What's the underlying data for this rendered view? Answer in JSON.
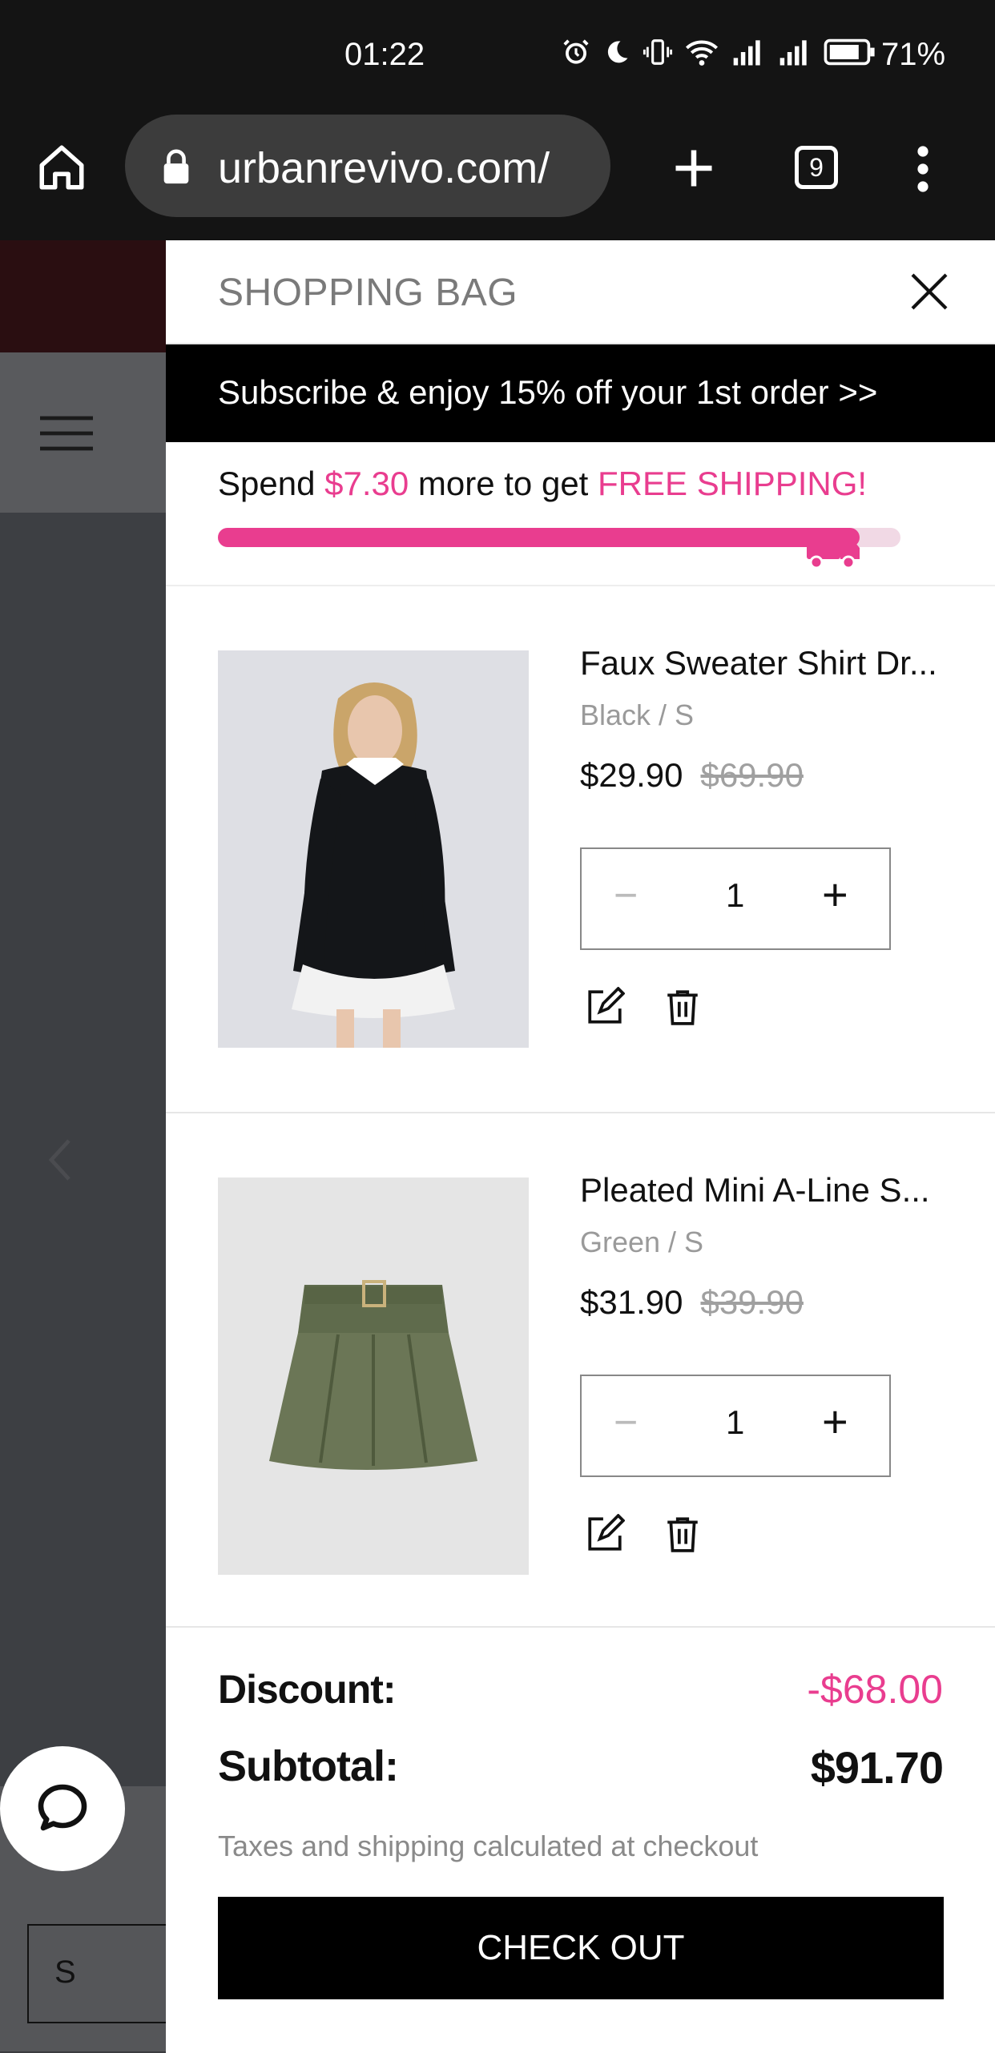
{
  "status_bar": {
    "time": "01:22",
    "battery": "71%"
  },
  "browser": {
    "url": "urbanrevivo.com/",
    "tab_count": "9"
  },
  "background_page": {
    "size_box": "S"
  },
  "drawer": {
    "title": "SHOPPING BAG",
    "promo": "Subscribe & enjoy 15% off your 1st order >>",
    "shipping": {
      "prefix": "Spend ",
      "amount": "$7.30",
      "middle": " more to get ",
      "free": "FREE SHIPPING!",
      "progress": 0.94
    },
    "items": [
      {
        "name": "Faux Sweater Shirt Dr...",
        "variant": "Black / S",
        "price": "$29.90",
        "old_price": "$69.90",
        "qty": "1",
        "minus": "−",
        "plus": "+"
      },
      {
        "name": "Pleated Mini A-Line S...",
        "variant": "Green / S",
        "price": "$31.90",
        "old_price": "$39.90",
        "qty": "1",
        "minus": "−",
        "plus": "+"
      }
    ],
    "summary": {
      "discount_label": "Discount:",
      "discount_value": "-$68.00",
      "subtotal_label": "Subtotal:",
      "subtotal_value": "$91.70",
      "note": "Taxes and shipping calculated at checkout",
      "checkout": "CHECK OUT"
    }
  },
  "colors": {
    "accent": "#e93d8f",
    "dark": "#141414"
  }
}
